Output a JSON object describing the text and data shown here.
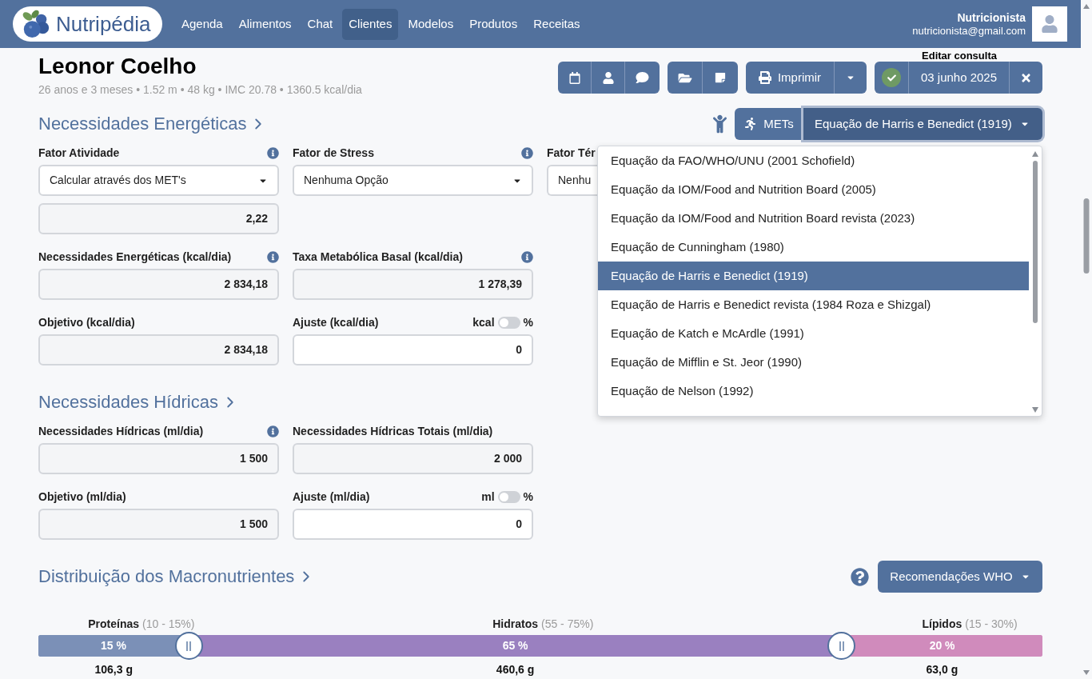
{
  "header": {
    "logo": "Nutripédia",
    "nav": [
      {
        "label": "Agenda",
        "selected": false
      },
      {
        "label": "Alimentos",
        "selected": false
      },
      {
        "label": "Chat",
        "selected": false
      },
      {
        "label": "Clientes",
        "selected": true
      },
      {
        "label": "Modelos",
        "selected": false
      },
      {
        "label": "Produtos",
        "selected": false
      },
      {
        "label": "Receitas",
        "selected": false
      }
    ],
    "user": {
      "name": "Nutricionista",
      "email": "nutricionista@gmail.com"
    }
  },
  "patient": {
    "name": "Leonor Coelho",
    "summary": "26 anos e 3 meses • 1.52 m • 48 kg • IMC 20.78 • 1360.5 kcal/dia"
  },
  "toolbar": {
    "print_label": "Imprimir",
    "consultation": {
      "caption": "Editar consulta",
      "confirmed": true,
      "date": "03 junho 2025"
    }
  },
  "energy": {
    "title": "Necessidades Energéticas",
    "mets_label": "METs",
    "equation": {
      "value": "Equação de Harris e Benedict (1919)",
      "expanded": true,
      "options": [
        {
          "label": "Equação da FAO/WHO/UNU (2001 Schofield)",
          "selected": false
        },
        {
          "label": "Equação da IOM/Food and Nutrition Board (2005)",
          "selected": false
        },
        {
          "label": "Equação da IOM/Food and Nutrition Board revista (2023)",
          "selected": false
        },
        {
          "label": "Equação de Cunningham (1980)",
          "selected": false
        },
        {
          "label": "Equação de Harris e Benedict (1919)",
          "selected": true
        },
        {
          "label": "Equação de Harris e Benedict revista (1984 Roza e Shizgal)",
          "selected": false
        },
        {
          "label": "Equação de Katch e McArdle (1991)",
          "selected": false
        },
        {
          "label": "Equação de Mifflin e St. Jeor (1990)",
          "selected": false
        },
        {
          "label": "Equação de Nelson (1992)",
          "selected": false
        }
      ]
    },
    "rows": [
      [
        {
          "label": "Fator Atividade",
          "info": true,
          "kind": "select",
          "value": "Calcular através dos MET's",
          "factor": "2,22"
        },
        {
          "label": "Fator de Stress",
          "info": true,
          "kind": "select",
          "value": "Nenhuma Opção"
        },
        {
          "label": "Fator Tér",
          "info": false,
          "kind": "select",
          "value": "Nenhu",
          "covered": true
        }
      ],
      [
        {
          "label": "Necessidades Energéticas (kcal/dia)",
          "info": true,
          "kind": "readonly",
          "value": "2 834,18"
        },
        {
          "label": "Taxa Metabólica Basal (kcal/dia)",
          "info": true,
          "kind": "readonly",
          "value": "1 278,39"
        }
      ],
      [
        {
          "label": "Objetivo (kcal/dia)",
          "info": false,
          "kind": "readonly",
          "value": "2 834,18"
        },
        {
          "label": "Ajuste (kcal/dia)",
          "info": false,
          "kind": "input",
          "value": "0",
          "toggle": {
            "left": "kcal",
            "right": "%",
            "on": false
          }
        }
      ]
    ]
  },
  "water": {
    "title": "Necessidades Hídricas",
    "rows": [
      [
        {
          "label": "Necessidades Hídricas (ml/dia)",
          "info": true,
          "kind": "readonly",
          "value": "1 500"
        },
        {
          "label": "Necessidades Hídricas Totais (ml/dia)",
          "info": false,
          "kind": "readonly",
          "value": "2 000"
        }
      ],
      [
        {
          "label": "Objetivo (ml/dia)",
          "info": false,
          "kind": "readonly",
          "value": "1 500"
        },
        {
          "label": "Ajuste (ml/dia)",
          "info": false,
          "kind": "input",
          "value": "0",
          "toggle": {
            "left": "ml",
            "right": "%",
            "on": false
          }
        }
      ]
    ]
  },
  "macros": {
    "title": "Distribuição dos Macronutrientes",
    "recommendation": "Recomendações WHO",
    "items": [
      {
        "name": "Proteínas",
        "range": "(10 - 15%)",
        "value": "15 %",
        "grams": "106,3 g",
        "color": "#7b90b7"
      },
      {
        "name": "Hidratos",
        "range": "(55 - 75%)",
        "value": "65 %",
        "grams": "460,6 g",
        "color": "#9a80c0"
      },
      {
        "name": "Lípidos",
        "range": "(15 - 30%)",
        "value": "20 %",
        "grams": "63,0 g",
        "color": "#d08bbc"
      }
    ],
    "handles": [
      {
        "level": 0.15
      },
      {
        "level": 0.8
      }
    ]
  }
}
